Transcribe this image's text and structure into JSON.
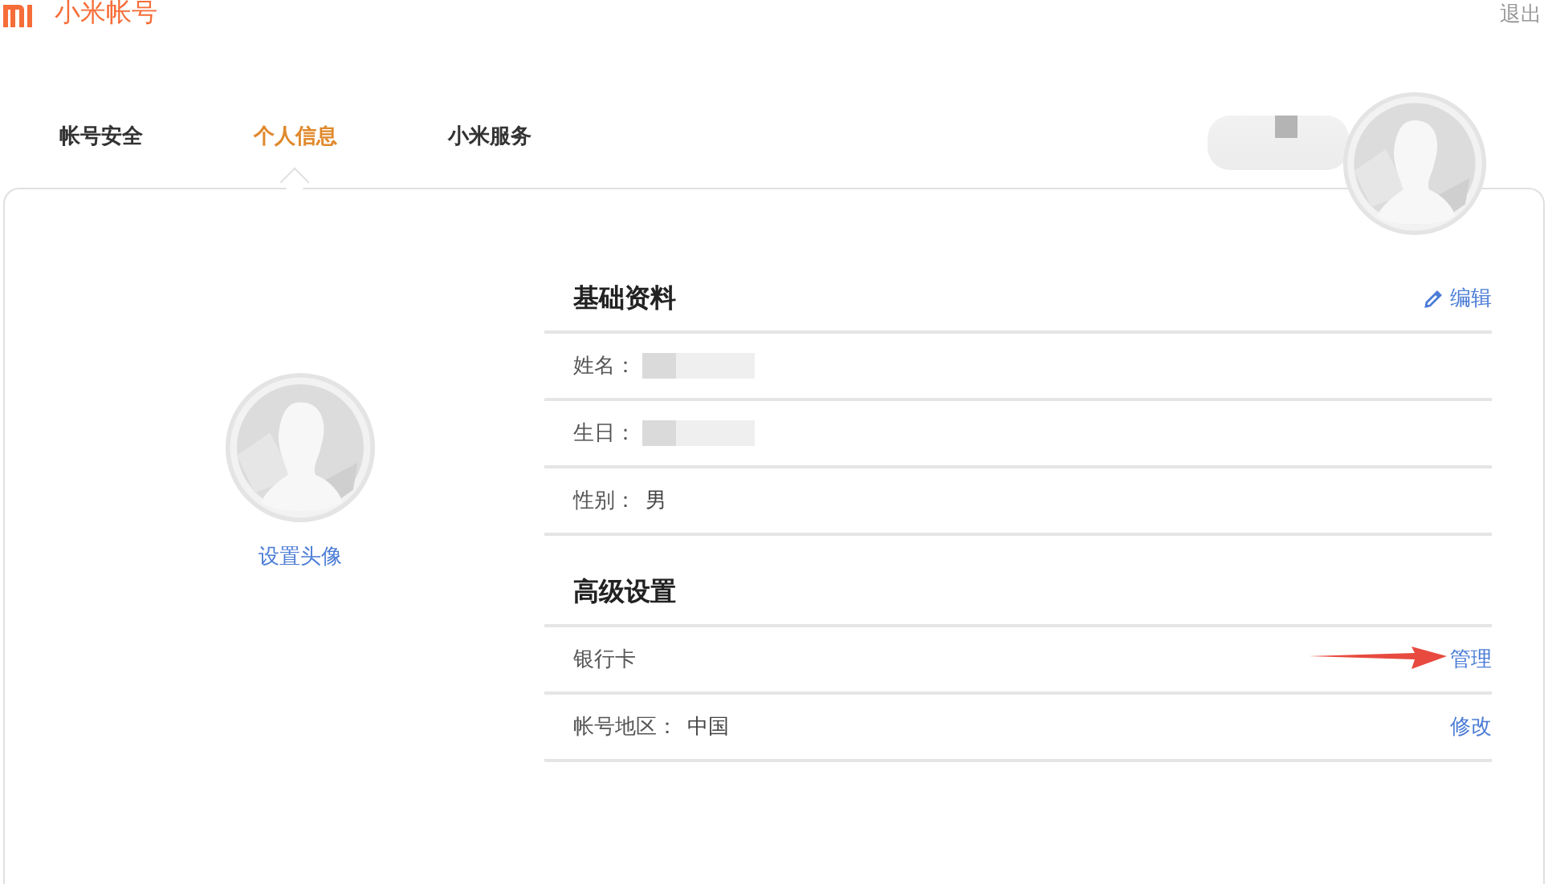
{
  "header": {
    "title": "小米帐号",
    "logout": "退出"
  },
  "tabs": [
    {
      "label": "帐号安全",
      "selected": false
    },
    {
      "label": "个人信息",
      "selected": true
    },
    {
      "label": "小米服务",
      "selected": false
    }
  ],
  "user": {
    "name_redacted": true
  },
  "avatar_panel": {
    "link": "设置头像"
  },
  "sections": [
    {
      "title": "基础资料",
      "action": "编辑",
      "rows": [
        {
          "kind": "field",
          "label": "姓名：",
          "redacted": true
        },
        {
          "kind": "field",
          "label": "生日：",
          "redacted": true
        },
        {
          "kind": "field",
          "label": "性别：",
          "value": "男"
        }
      ]
    },
    {
      "title": "高级设置",
      "rows": [
        {
          "kind": "link",
          "label": "银行卡",
          "action": "管理",
          "annotated": true
        },
        {
          "kind": "link",
          "label": "帐号地区：",
          "value": "中国",
          "action": "修改"
        }
      ]
    }
  ]
}
